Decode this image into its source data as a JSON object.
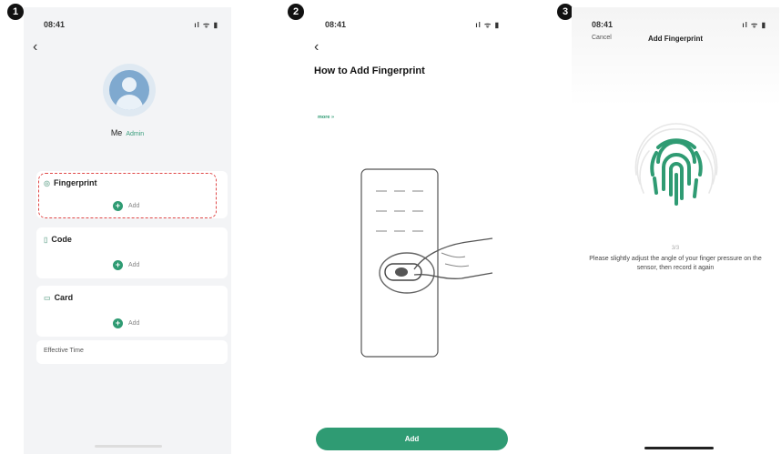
{
  "steps": [
    "1",
    "2",
    "3"
  ],
  "status": {
    "time1": "08:41",
    "time2": "08:41",
    "time3": "08:41",
    "icons": "ıl ᯤ ▮"
  },
  "icons": {
    "back": "chevron-left-icon",
    "avatar": "user-avatar-icon",
    "plus": "plus-circle-icon",
    "fingerprint": "fingerprint-icon"
  },
  "screen1": {
    "user_name": "Me",
    "user_tag": "Admin",
    "sub_text": "",
    "fingerprint": {
      "title": "Fingerprint",
      "add": "Add"
    },
    "code": {
      "title": "Code",
      "add": "Add"
    },
    "card": {
      "title": "Card",
      "add": "Add"
    },
    "effective_time": {
      "label": "Effective Time",
      "value": ""
    }
  },
  "screen2": {
    "title": "How to Add Fingerprint",
    "para1": "",
    "para2": "",
    "more_link": "more »",
    "add_button": "Add"
  },
  "screen3": {
    "cancel": "Cancel",
    "title": "Add Fingerprint",
    "count": "3/3",
    "instruction": "Please slightly adjust the angle of your finger pressure on the sensor, then record it again",
    "hint": ""
  },
  "colors": {
    "accent": "#2f9b73",
    "highlight": "#e04848"
  }
}
